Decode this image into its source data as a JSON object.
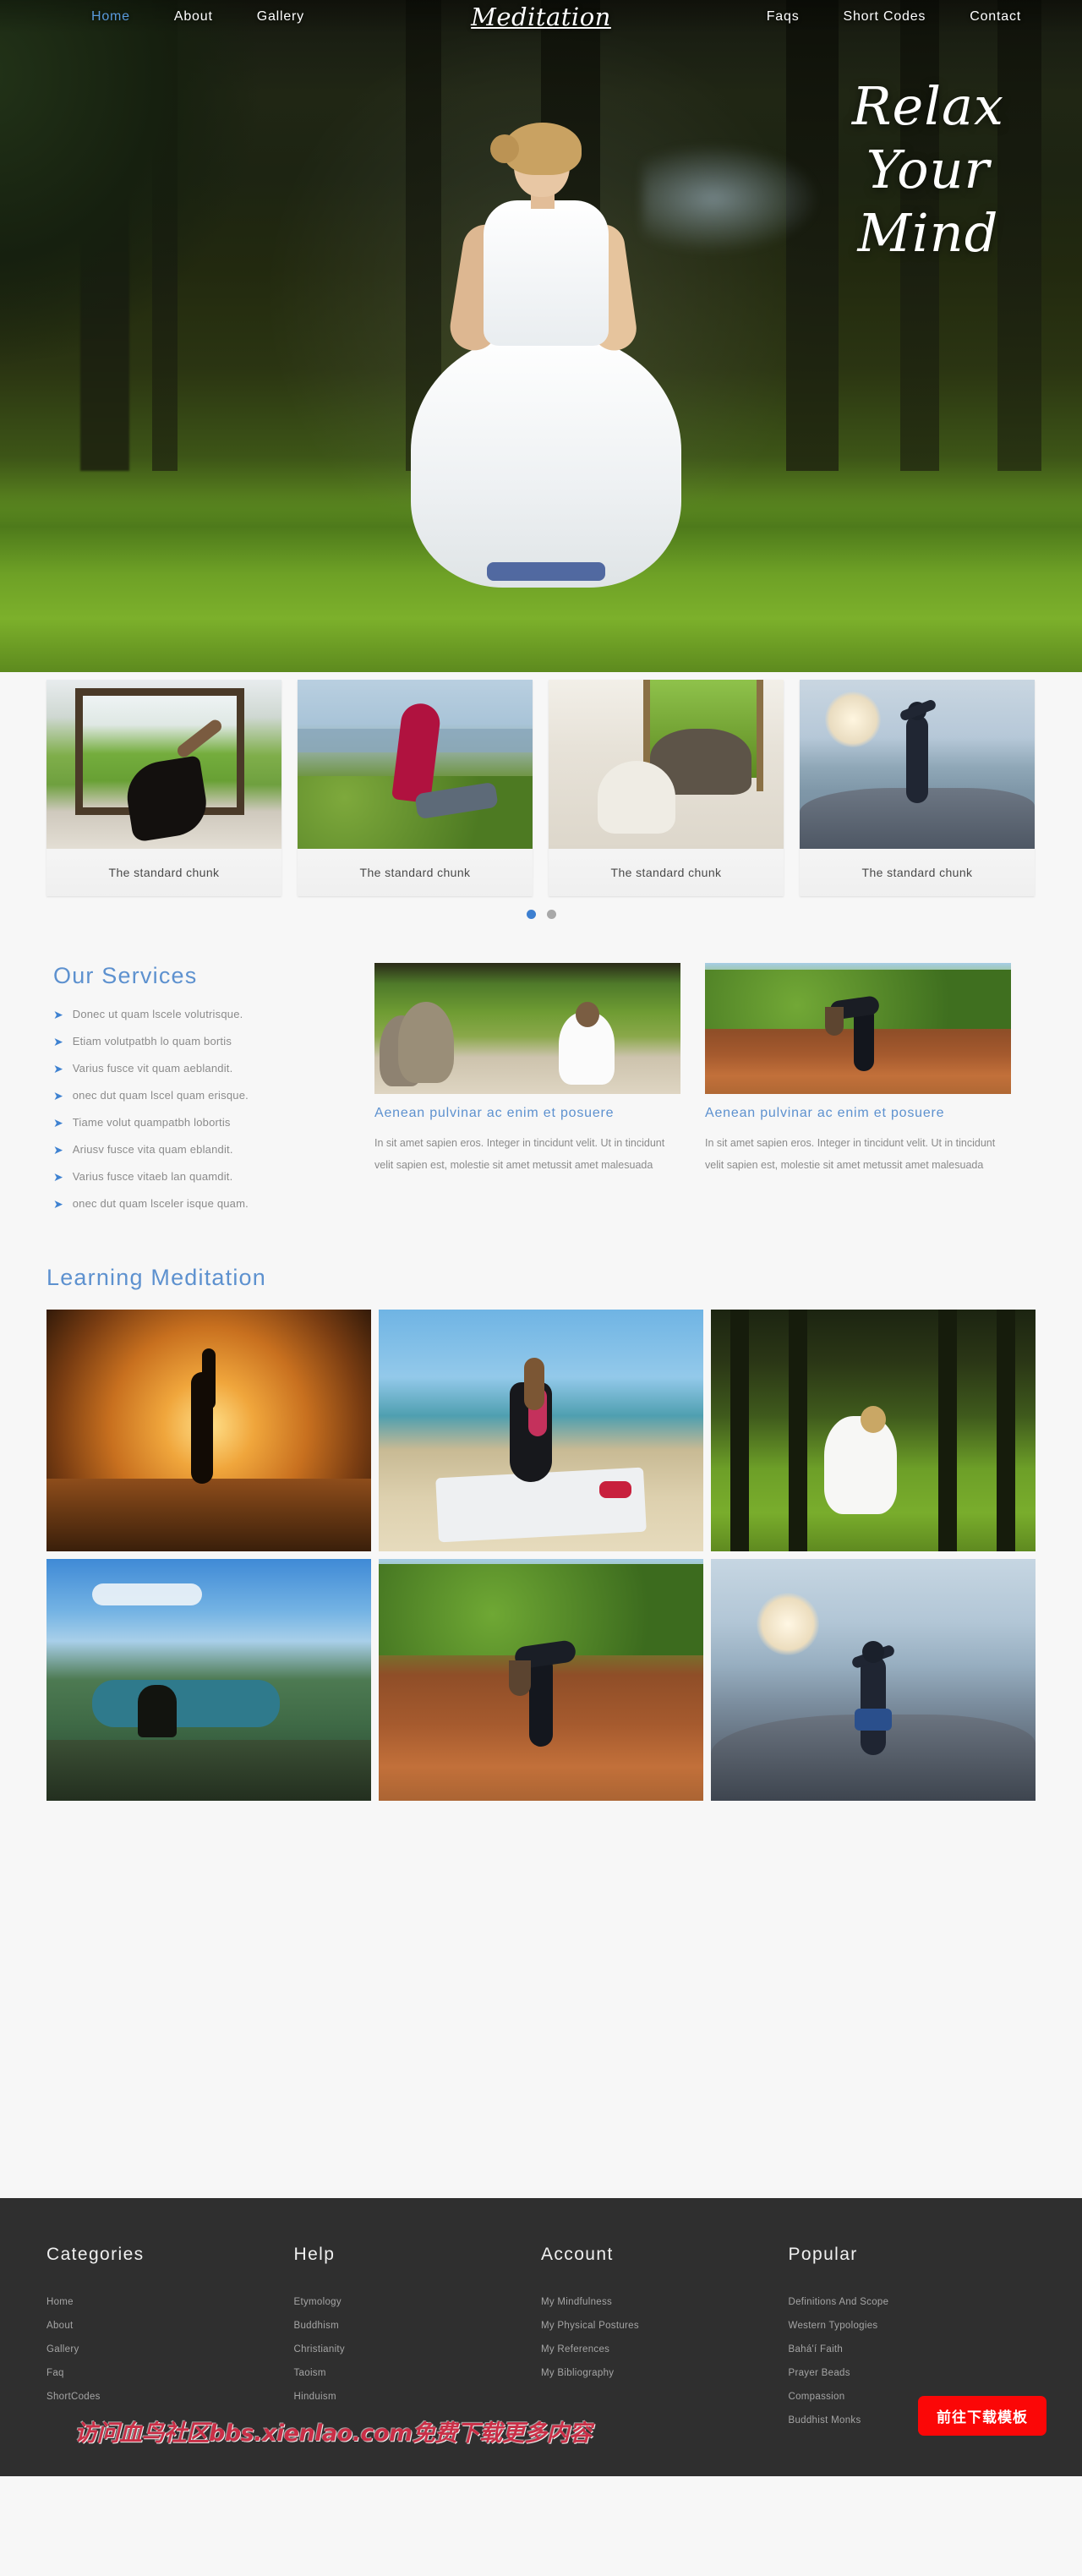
{
  "nav": {
    "brand": "Meditation",
    "left_items": [
      {
        "label": "Home",
        "active": true
      },
      {
        "label": "About",
        "active": false
      },
      {
        "label": "Gallery",
        "active": false
      }
    ],
    "right_items": [
      {
        "label": "Faqs"
      },
      {
        "label": "Short Codes"
      },
      {
        "label": "Contact"
      }
    ]
  },
  "hero": {
    "line1": "Relax",
    "line2": "Your",
    "line3": "Mind"
  },
  "carousel": {
    "cards": [
      {
        "caption": "The standard chunk",
        "scene": "sc-window"
      },
      {
        "caption": "The standard chunk",
        "scene": "sc-hill"
      },
      {
        "caption": "The standard chunk",
        "scene": "sc-white"
      },
      {
        "caption": "The standard chunk",
        "scene": "sc-beach"
      }
    ],
    "dots": [
      {
        "active": true
      },
      {
        "active": false
      }
    ]
  },
  "services": {
    "title": "Our Services",
    "arrow_icon": "arrow-right-icon",
    "items": [
      "Donec ut quam lscele volutrisque.",
      "Etiam volutpatbh lo quam bortis",
      "Varius fusce vit quam aeblandit.",
      "onec dut quam lscel quam erisque.",
      "Tiame volut quampatbh lobortis",
      "Ariusv fusce vita quam eblandit.",
      "Varius fusce vitaeb lan quamdit.",
      "onec dut quam lsceler isque quam."
    ],
    "cards": [
      {
        "heading": "Aenean pulvinar ac enim et posuere",
        "body": "In sit amet sapien eros. Integer in tincidunt velit. Ut in tincidunt velit sapien est, molestie sit amet metussit amet malesuada"
      },
      {
        "heading": "Aenean pulvinar ac enim et posuere",
        "body": "In sit amet sapien eros. Integer in tincidunt velit. Ut in tincidunt velit sapien est, molestie sit amet metussit amet malesuada"
      }
    ]
  },
  "gallery": {
    "title": "Learning Meditation",
    "cells": [
      {
        "name": "sunset-tree-pose"
      },
      {
        "name": "beach-seated-meditation"
      },
      {
        "name": "forest-white-dress-meditation"
      },
      {
        "name": "mountain-lake-overlook"
      },
      {
        "name": "river-forward-fold"
      },
      {
        "name": "coastal-rock-tree-pose"
      }
    ]
  },
  "footer": {
    "columns": [
      {
        "heading": "Categories",
        "links": [
          "Home",
          "About",
          "Gallery",
          "Faq",
          "ShortCodes"
        ]
      },
      {
        "heading": "Help",
        "links": [
          "Etymology",
          "Buddhism",
          "Christianity",
          "Taoism",
          "Hinduism"
        ]
      },
      {
        "heading": "Account",
        "links": [
          "My Mindfulness",
          "My Physical Postures",
          "My References",
          "My Bibliography"
        ]
      },
      {
        "heading": "Popular",
        "links": [
          "Definitions And Scope",
          "Western Typologies",
          "Bahá'í Faith",
          "Prayer Beads",
          "Compassion",
          "Buddhist Monks"
        ]
      }
    ],
    "watermark": "访问血鸟社区bbs.xienlao.com免费下载更多内容",
    "download_button": "前往下载模板"
  },
  "colors": {
    "accent_blue": "#5d91cf",
    "nav_active": "#5a9bdc",
    "footer_bg": "#2f2f2f",
    "page_bg": "#f7f7f7",
    "download_red": "#fb0707"
  }
}
